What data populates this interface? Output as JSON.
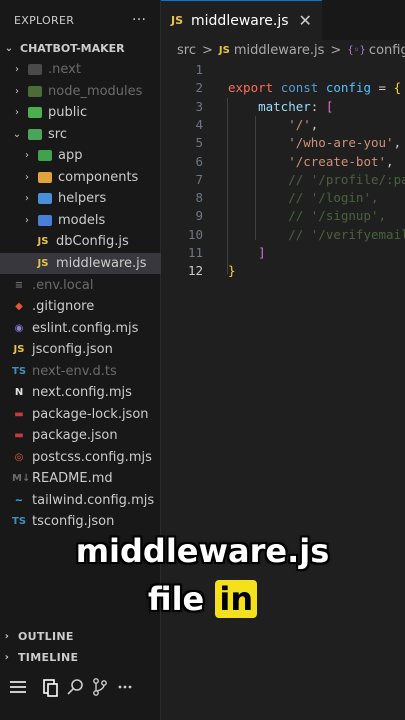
{
  "sidebar": {
    "title": "EXPLORER",
    "more": "···",
    "project": "CHATBOT-MAKER",
    "items": [
      {
        "label": ".next",
        "type": "folder",
        "depth": 1,
        "open": false,
        "dim": true,
        "icon": "next-folder-icon",
        "color": "#6d6d6d"
      },
      {
        "label": "node_modules",
        "type": "folder",
        "depth": 1,
        "open": false,
        "dim": true,
        "icon": "node-folder-icon",
        "color": "#6fa44b"
      },
      {
        "label": "public",
        "type": "folder",
        "depth": 1,
        "open": false,
        "dim": false,
        "icon": "public-folder-icon",
        "color": "#4bb04b"
      },
      {
        "label": "src",
        "type": "folder",
        "depth": 1,
        "open": true,
        "dim": false,
        "icon": "src-folder-icon",
        "color": "#4aa55a"
      },
      {
        "label": "app",
        "type": "folder",
        "depth": 2,
        "open": false,
        "dim": false,
        "icon": "app-folder-icon",
        "color": "#3fa34d"
      },
      {
        "label": "components",
        "type": "folder",
        "depth": 2,
        "open": false,
        "dim": false,
        "icon": "components-folder-icon",
        "color": "#e0a43b"
      },
      {
        "label": "helpers",
        "type": "folder",
        "depth": 2,
        "open": false,
        "dim": false,
        "icon": "helpers-folder-icon",
        "color": "#4a90d9"
      },
      {
        "label": "models",
        "type": "folder",
        "depth": 2,
        "open": false,
        "dim": false,
        "icon": "models-folder-icon",
        "color": "#4a7fd9"
      },
      {
        "label": "dbConfig.js",
        "type": "file",
        "depth": 3,
        "dim": false,
        "icon": "js-icon",
        "glyph": "JS",
        "color": "#e8c547"
      },
      {
        "label": "middleware.js",
        "type": "file",
        "depth": 3,
        "dim": false,
        "icon": "js-icon",
        "glyph": "JS",
        "color": "#e8c547",
        "selected": true
      },
      {
        "label": ".env.local",
        "type": "file",
        "depth": 1,
        "dim": true,
        "icon": "env-icon",
        "glyph": "≡",
        "color": "#6d6d6d"
      },
      {
        "label": ".gitignore",
        "type": "file",
        "depth": 1,
        "dim": false,
        "icon": "git-icon",
        "glyph": "◆",
        "color": "#e45635"
      },
      {
        "label": "eslint.config.mjs",
        "type": "file",
        "depth": 1,
        "dim": false,
        "icon": "eslint-icon",
        "glyph": "◉",
        "color": "#8b7dd8"
      },
      {
        "label": "jsconfig.json",
        "type": "file",
        "depth": 1,
        "dim": false,
        "icon": "json-js-icon",
        "glyph": "JS",
        "color": "#e8c547"
      },
      {
        "label": "next-env.d.ts",
        "type": "file",
        "depth": 1,
        "dim": true,
        "icon": "ts-icon",
        "glyph": "TS",
        "color": "#3f8fbf"
      },
      {
        "label": "next.config.mjs",
        "type": "file",
        "depth": 1,
        "dim": false,
        "icon": "next-icon",
        "glyph": "N",
        "color": "#e0e0e0"
      },
      {
        "label": "package-lock.json",
        "type": "file",
        "depth": 1,
        "dim": false,
        "icon": "npm-icon",
        "glyph": "▬",
        "color": "#c43b3b"
      },
      {
        "label": "package.json",
        "type": "file",
        "depth": 1,
        "dim": false,
        "icon": "npm-icon",
        "glyph": "▬",
        "color": "#c43b3b"
      },
      {
        "label": "postcss.config.mjs",
        "type": "file",
        "depth": 1,
        "dim": false,
        "icon": "postcss-icon",
        "glyph": "◎",
        "color": "#e0643b"
      },
      {
        "label": "README.md",
        "type": "file",
        "depth": 1,
        "dim": false,
        "icon": "markdown-icon",
        "glyph": "M↓",
        "color": "#6b6b6b"
      },
      {
        "label": "tailwind.config.mjs",
        "type": "file",
        "depth": 1,
        "dim": false,
        "icon": "tailwind-icon",
        "glyph": "~",
        "color": "#38bdf8"
      },
      {
        "label": "tsconfig.json",
        "type": "file",
        "depth": 1,
        "dim": false,
        "icon": "tsconfig-icon",
        "glyph": "TS",
        "color": "#3f8fbf"
      }
    ]
  },
  "tab": {
    "icon_glyph": "JS",
    "label": "middleware.js",
    "close": "✕"
  },
  "breadcrumb": {
    "part1": "src",
    "sep": ">",
    "part2": "middleware.js",
    "part3_glyph": "{◦}",
    "part3": "config"
  },
  "code": {
    "lines": [
      {
        "n": "1",
        "tokens": [
          {
            "t": "",
            "c": ""
          }
        ],
        "current": false
      },
      {
        "n": "2",
        "tokens": [
          {
            "t": "export ",
            "c": "kw2"
          },
          {
            "t": "const ",
            "c": "kw"
          },
          {
            "t": "config",
            "c": "var"
          },
          {
            "t": " = ",
            "c": ""
          },
          {
            "t": "{",
            "c": "brk1"
          }
        ],
        "current": false
      },
      {
        "n": "3",
        "tokens": [
          {
            "t": "    matcher",
            "c": "prop"
          },
          {
            "t": ": ",
            "c": ""
          },
          {
            "t": "[",
            "c": "brk2"
          }
        ],
        "current": false
      },
      {
        "n": "4",
        "tokens": [
          {
            "t": "        '/'",
            "c": "str"
          },
          {
            "t": ",",
            "c": ""
          }
        ],
        "current": false
      },
      {
        "n": "5",
        "tokens": [
          {
            "t": "        '/who-are-you'",
            "c": "str"
          },
          {
            "t": ",",
            "c": ""
          }
        ],
        "current": false
      },
      {
        "n": "6",
        "tokens": [
          {
            "t": "        '/create-bot'",
            "c": "str"
          },
          {
            "t": ",",
            "c": ""
          }
        ],
        "current": false
      },
      {
        "n": "7",
        "tokens": [
          {
            "t": "        // '/profile/:pa",
            "c": "cmt"
          }
        ],
        "current": false
      },
      {
        "n": "8",
        "tokens": [
          {
            "t": "        // '/login',",
            "c": "cmt"
          }
        ],
        "current": false
      },
      {
        "n": "9",
        "tokens": [
          {
            "t": "        // '/signup',",
            "c": "cmt"
          }
        ],
        "current": false
      },
      {
        "n": "10",
        "tokens": [
          {
            "t": "        // '/verifyemail",
            "c": "cmt"
          }
        ],
        "current": false
      },
      {
        "n": "11",
        "tokens": [
          {
            "t": "    ]",
            "c": "brk2"
          }
        ],
        "current": false
      },
      {
        "n": "12",
        "tokens": [
          {
            "t": "}",
            "c": "brk1"
          }
        ],
        "current": true
      }
    ]
  },
  "panels": {
    "outline": "OUTLINE",
    "timeline": "TIMELINE"
  },
  "caption": {
    "line1": "middleware.js",
    "line2_a": "file ",
    "line2_b": "in"
  },
  "colors": {
    "accent": "#0078d4",
    "highlight": "#f5e11b"
  }
}
